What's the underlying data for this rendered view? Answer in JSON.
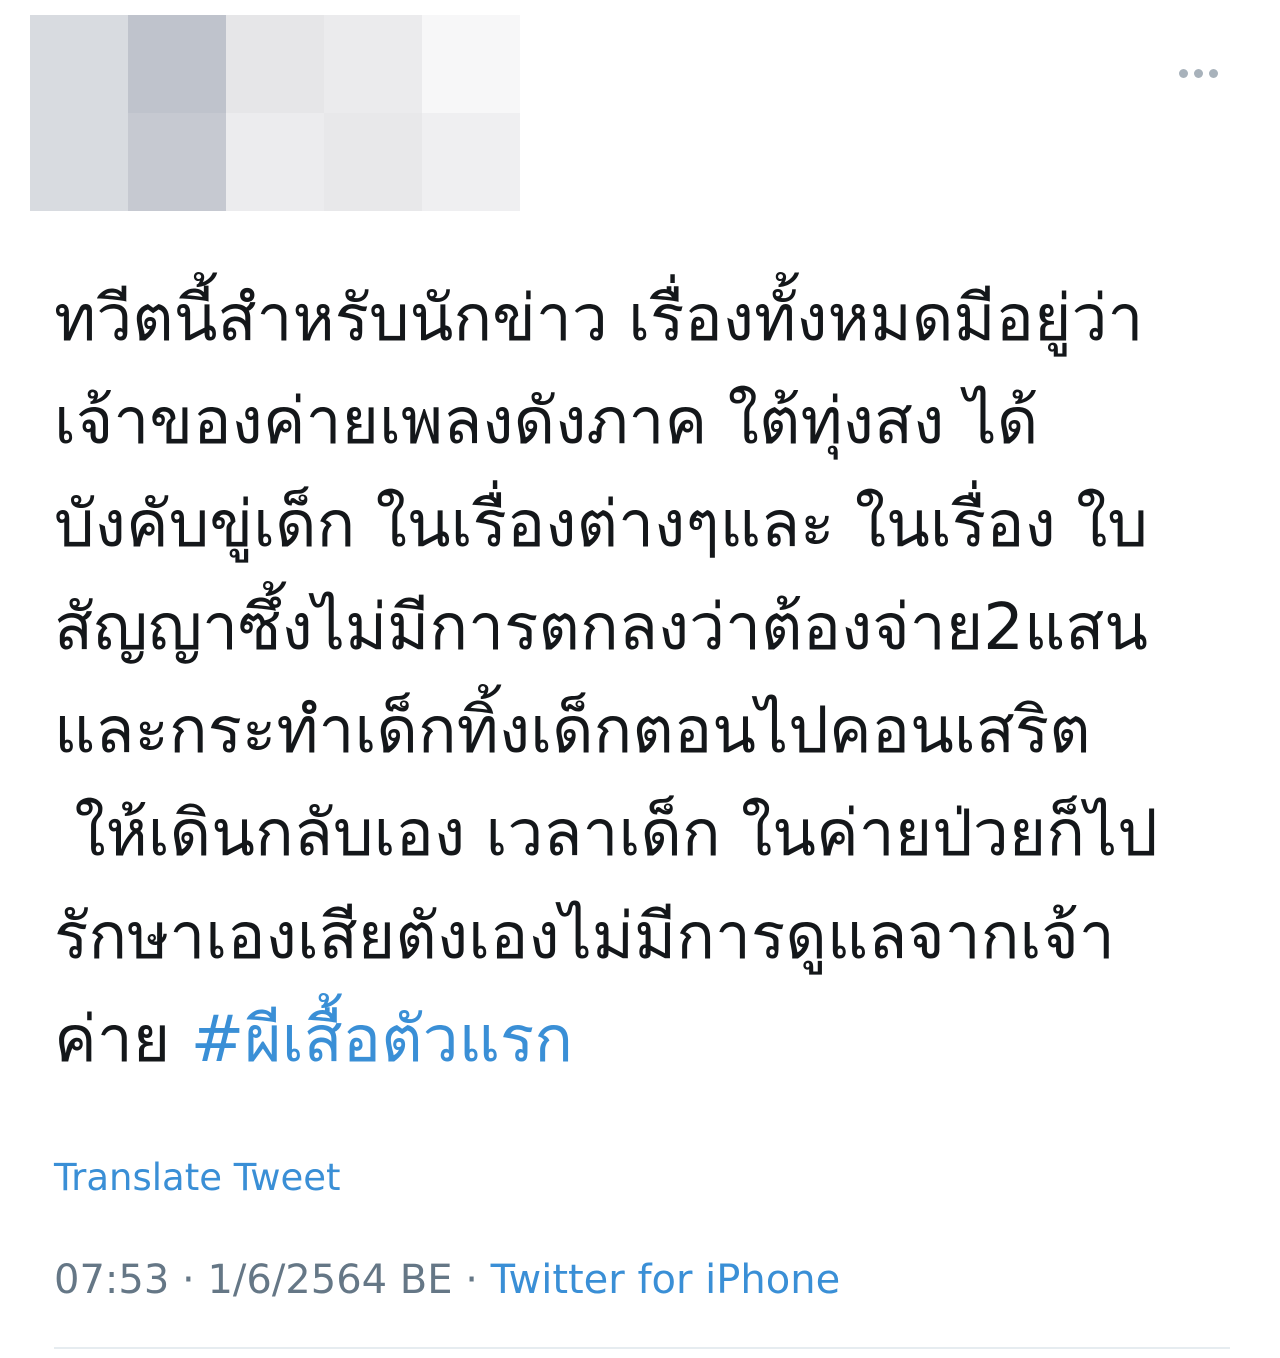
{
  "avatar_blur": {
    "cells": [
      "#d8dbe0",
      "#bfc3cc",
      "#e6e6e8",
      "#ebebed",
      "#f7f7f8",
      "#d8dbe0",
      "#c6c9d1",
      "#ececee",
      "#e8e8ea",
      "#efeff1"
    ]
  },
  "menu": {
    "icon": "more-dots-icon"
  },
  "tweet": {
    "lines": [
      "ทวีตนี้สำหรับนักข่าว เรื่องทั้งหมดมีอยู่ว่า",
      "เจ้าของค่ายเพลงดังภาค ใต้ทุ่งสง ได้",
      "บังคับขู่เด็ก ในเรื่องต่างๆและ ในเรื่อง ใบ",
      "สัญญาซึ้งไม่มีการตกลงว่าต้องจ่าย2แสน",
      "และกระทำเด็กทิ้งเด็กตอนไปคอนเสริต",
      " ให้เดินกลับเอง เวลาเด็ก ในค่ายป่วยก็ไป",
      "รักษาเองเสียตังเองไม่มีการดูแลจากเจ้า",
      "ค่าย "
    ],
    "hashtag": "#ผีเสื้อตัวแรก"
  },
  "translate_label": "Translate Tweet",
  "meta": {
    "time": "07:53",
    "separator": " · ",
    "date": "1/6/2564 BE",
    "source": "Twitter for iPhone"
  },
  "colors": {
    "link": "#3a8fd6",
    "text": "#14171a",
    "muted": "#657786"
  }
}
